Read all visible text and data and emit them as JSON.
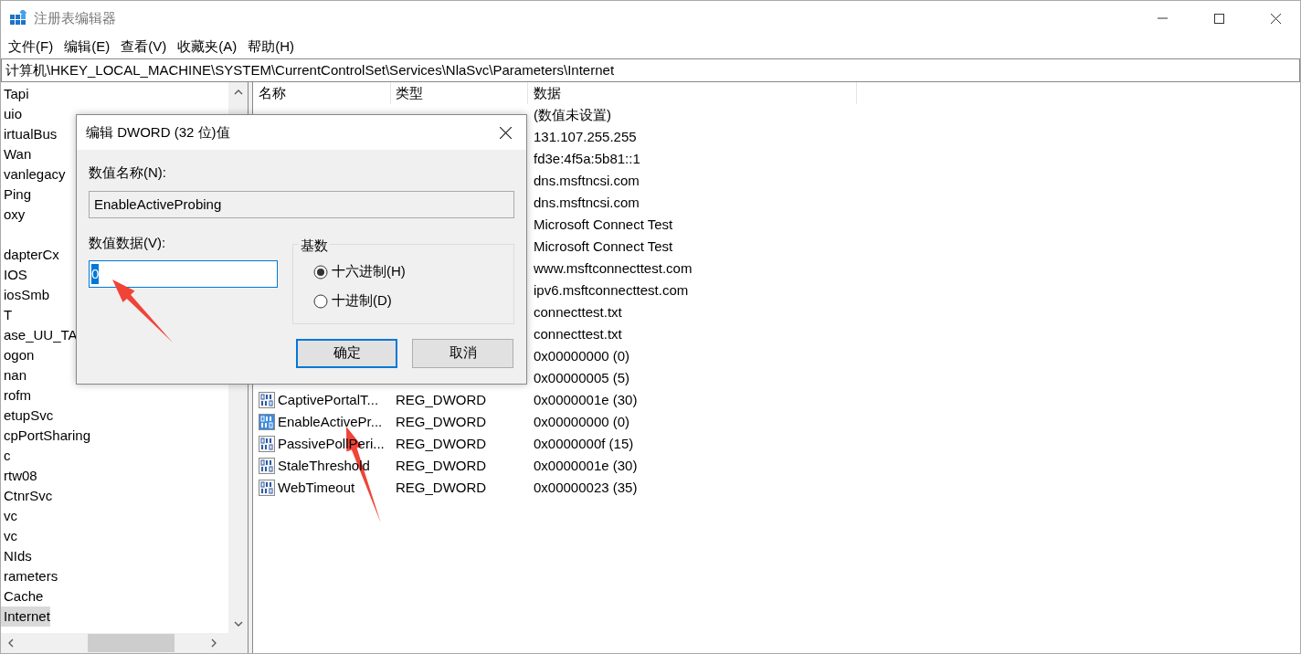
{
  "window": {
    "title": "注册表编辑器"
  },
  "menu": [
    "文件(F)",
    "编辑(E)",
    "查看(V)",
    "收藏夹(A)",
    "帮助(H)"
  ],
  "address": "计算机\\HKEY_LOCAL_MACHINE\\SYSTEM\\CurrentControlSet\\Services\\NlaSvc\\Parameters\\Internet",
  "tree": {
    "items": [
      {
        "label": "Tapi",
        "selected": false
      },
      {
        "label": "uio",
        "selected": false
      },
      {
        "label": "irtualBus",
        "selected": false
      },
      {
        "label": "Wan",
        "selected": false
      },
      {
        "label": "vanlegacy",
        "selected": false
      },
      {
        "label": "Ping",
        "selected": false
      },
      {
        "label": "oxy",
        "selected": false
      },
      {
        "label": "dapterCx",
        "selected": false,
        "gap_before": true
      },
      {
        "label": "IOS",
        "selected": false
      },
      {
        "label": "iosSmb",
        "selected": false
      },
      {
        "label": "T",
        "selected": false
      },
      {
        "label": "ase_UU_TA",
        "selected": false
      },
      {
        "label": "ogon",
        "selected": false
      },
      {
        "label": "nan",
        "selected": false
      },
      {
        "label": "rofm",
        "selected": false
      },
      {
        "label": "etupSvc",
        "selected": false
      },
      {
        "label": "cpPortSharing",
        "selected": false
      },
      {
        "label": "c",
        "selected": false
      },
      {
        "label": "rtw08",
        "selected": false
      },
      {
        "label": "CtnrSvc",
        "selected": false
      },
      {
        "label": "vc",
        "selected": false
      },
      {
        "label": "vc",
        "selected": false
      },
      {
        "label": "NIds",
        "selected": false
      },
      {
        "label": "rameters",
        "selected": false
      },
      {
        "label": "Cache",
        "selected": false
      },
      {
        "label": "Internet",
        "selected": true
      }
    ]
  },
  "list": {
    "columns": [
      "名称",
      "类型",
      "数据"
    ],
    "rows": [
      {
        "data": "(数值未设置)",
        "selected": false
      },
      {
        "data": "131.107.255.255",
        "selected": false
      },
      {
        "data": "fd3e:4f5a:5b81::1",
        "selected": false
      },
      {
        "data": "dns.msftncsi.com",
        "selected": false
      },
      {
        "data": "dns.msftncsi.com",
        "selected": false
      },
      {
        "data": "Microsoft Connect Test",
        "selected": false
      },
      {
        "data": "Microsoft Connect Test",
        "selected": false
      },
      {
        "data": "www.msftconnecttest.com",
        "selected": false
      },
      {
        "data": "ipv6.msftconnecttest.com",
        "selected": false
      },
      {
        "data": "connecttest.txt",
        "selected": false
      },
      {
        "data": "connecttest.txt",
        "selected": false
      },
      {
        "data": "0x00000000 (0)",
        "selected": false
      },
      {
        "data": "0x00000005 (5)",
        "selected": false
      },
      {
        "name": "CaptivePortalT...",
        "type": "REG_DWORD",
        "data": "0x0000001e (30)",
        "selected": false
      },
      {
        "name": "EnableActivePr...",
        "type": "REG_DWORD",
        "data": "0x00000000 (0)",
        "selected": true
      },
      {
        "name": "PassivePollPeri...",
        "type": "REG_DWORD",
        "data": "0x0000000f (15)",
        "selected": false
      },
      {
        "name": "StaleThreshold",
        "type": "REG_DWORD",
        "data": "0x0000001e (30)",
        "selected": false
      },
      {
        "name": "WebTimeout",
        "type": "REG_DWORD",
        "data": "0x00000023 (35)",
        "selected": false
      }
    ]
  },
  "dialog": {
    "title": "编辑 DWORD (32 位)值",
    "name_label": "数值名称(N):",
    "name_value": "EnableActiveProbing",
    "data_label": "数值数据(V):",
    "data_value": "0",
    "base_label": "基数",
    "radios": [
      {
        "label": "十六进制(H)",
        "selected": true
      },
      {
        "label": "十进制(D)",
        "selected": false
      }
    ],
    "buttons": [
      {
        "label": "确定",
        "default": true
      },
      {
        "label": "取消",
        "default": false
      }
    ]
  },
  "annotations": [
    {
      "kind": "arrow"
    },
    {
      "kind": "arrow"
    }
  ]
}
